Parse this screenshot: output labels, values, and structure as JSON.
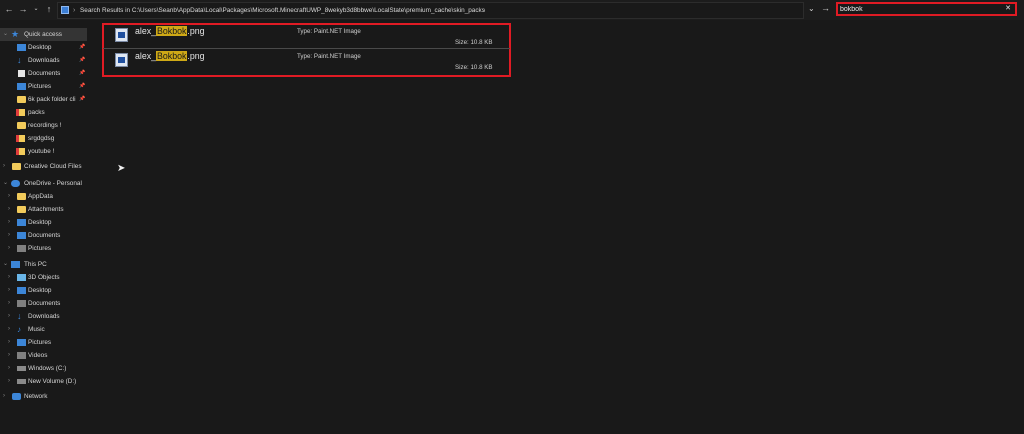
{
  "address": {
    "path": "Search Results in C:\\Users\\Seanb\\AppData\\Local\\Packages\\Microsoft.MinecraftUWP_8wekyb3d8bbwe\\LocalState\\premium_cache\\skin_packs",
    "separator": "›"
  },
  "search": {
    "value": "bokbok",
    "placeholder": ""
  },
  "sidebar": {
    "items": [
      {
        "label": "Quick access"
      },
      {
        "label": "Desktop"
      },
      {
        "label": "Downloads"
      },
      {
        "label": "Documents"
      },
      {
        "label": "Pictures"
      },
      {
        "label": "6k pack folder cli"
      },
      {
        "label": "packs"
      },
      {
        "label": "recordings !"
      },
      {
        "label": "srgdgdsg"
      },
      {
        "label": "youtube !"
      },
      {
        "label": "Creative Cloud Files"
      },
      {
        "label": "OneDrive - Personal"
      },
      {
        "label": "AppData"
      },
      {
        "label": "Attachments"
      },
      {
        "label": "Desktop"
      },
      {
        "label": "Documents"
      },
      {
        "label": "Pictures"
      },
      {
        "label": "This PC"
      },
      {
        "label": "3D Objects"
      },
      {
        "label": "Desktop"
      },
      {
        "label": "Documents"
      },
      {
        "label": "Downloads"
      },
      {
        "label": "Music"
      },
      {
        "label": "Pictures"
      },
      {
        "label": "Videos"
      },
      {
        "label": "Windows (C:)"
      },
      {
        "label": "New Volume (D:)"
      },
      {
        "label": "Network"
      }
    ]
  },
  "results": [
    {
      "name_prefix": "alex_",
      "name_match": "Bokbok",
      "name_suffix": ".png",
      "type": "Type: Paint.NET Image",
      "size": "Size: 10.8 KB"
    },
    {
      "name_prefix": "alex_",
      "name_match": "Bokbok",
      "name_suffix": ".png",
      "type": "Type: Paint.NET Image",
      "size": "Size: 10.8 KB"
    }
  ],
  "colors": {
    "highlight": "#cfa916",
    "annotation": "#e01b24",
    "background": "#191919"
  }
}
